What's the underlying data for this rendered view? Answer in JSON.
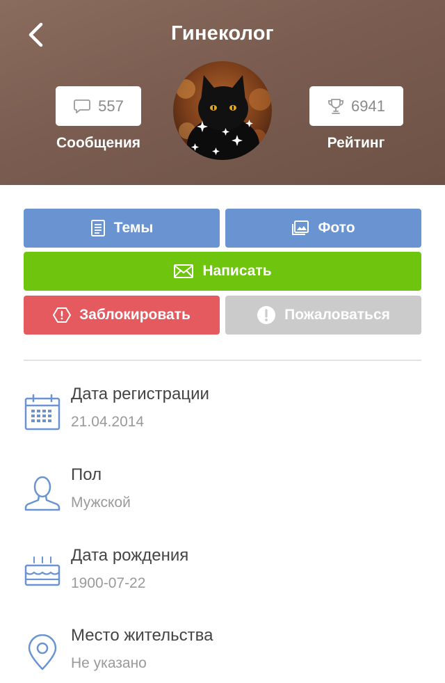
{
  "header": {
    "title": "Гинеколог",
    "background_color": "#7a5d50"
  },
  "stats": {
    "messages": {
      "count": "557",
      "label": "Сообщения",
      "icon": "chat-bubble-icon"
    },
    "rating": {
      "count": "6941",
      "label": "Рейтинг",
      "icon": "trophy-icon"
    }
  },
  "avatar": {
    "description_icon": "black-cat-avatar"
  },
  "actions": {
    "topics": {
      "label": "Темы",
      "icon": "document-icon",
      "color": "#6a94d1"
    },
    "photo": {
      "label": "Фото",
      "icon": "photo-icon",
      "color": "#6a94d1"
    },
    "write": {
      "label": "Написать",
      "icon": "envelope-icon",
      "color": "#6fc40d"
    },
    "block": {
      "label": "Заблокировать",
      "icon": "stop-octagon-icon",
      "color": "#e45a5f"
    },
    "report": {
      "label": "Пожаловаться",
      "icon": "exclamation-icon",
      "color": "#cbcbcb"
    }
  },
  "info": [
    {
      "title": "Дата регистрации",
      "value": "21.04.2014",
      "icon": "calendar-icon"
    },
    {
      "title": "Пол",
      "value": "Мужской",
      "icon": "user-icon"
    },
    {
      "title": "Дата рождения",
      "value": "1900-07-22",
      "icon": "birthday-cake-icon"
    },
    {
      "title": "Место жительства",
      "value": "Не указано",
      "icon": "location-pin-icon"
    }
  ]
}
